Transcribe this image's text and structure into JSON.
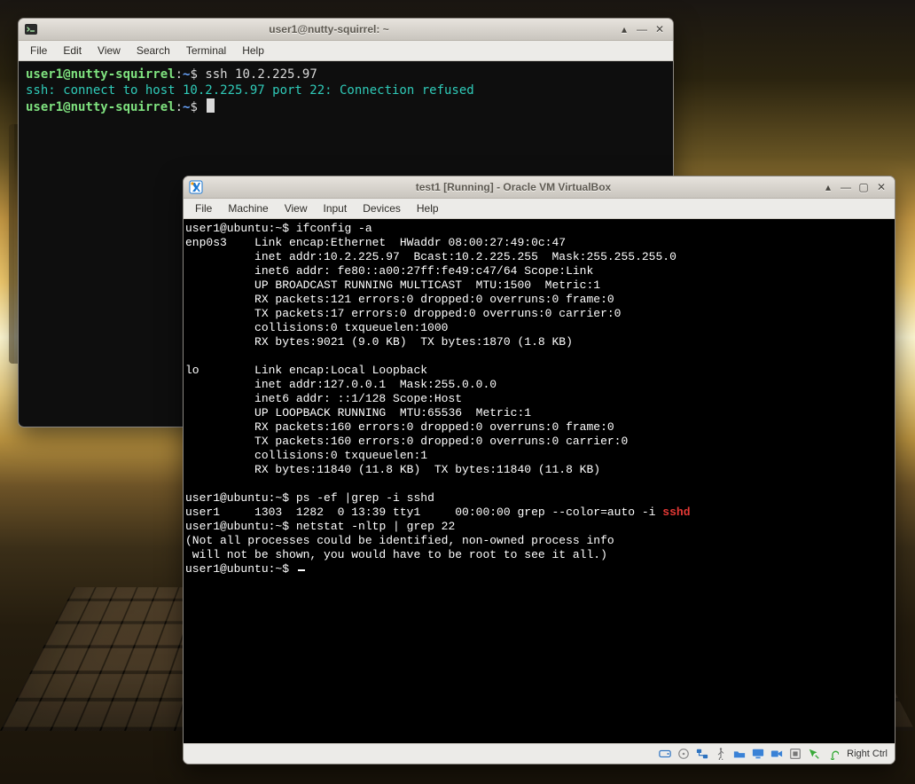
{
  "desktop": {
    "dock": true
  },
  "term_window": {
    "title": "user1@nutty-squirrel: ~",
    "menus": [
      "File",
      "Edit",
      "View",
      "Search",
      "Terminal",
      "Help"
    ],
    "prompt": {
      "userhost": "user1@nutty-squirrel",
      "sep1": ":",
      "path": "~",
      "sep2": "$"
    },
    "lines": {
      "cmd1": "ssh 10.2.225.97",
      "out1": "ssh: connect to host 10.2.225.97 port 22: Connection refused"
    },
    "ctl": {
      "up": "▴",
      "min": "—",
      "close": "✕"
    }
  },
  "vbox_window": {
    "title": "test1 [Running] - Oracle VM VirtualBox",
    "menus": [
      "File",
      "Machine",
      "View",
      "Input",
      "Devices",
      "Help"
    ],
    "ctl": {
      "up": "▴",
      "min": "—",
      "max": "▢",
      "close": "✕"
    },
    "host_key": "Right Ctrl",
    "console": {
      "p": "user1@ubuntu:~$",
      "c1": "ifconfig -a",
      "if1": [
        "enp0s3    Link encap:Ethernet  HWaddr 08:00:27:49:0c:47",
        "          inet addr:10.2.225.97  Bcast:10.2.225.255  Mask:255.255.255.0",
        "          inet6 addr: fe80::a00:27ff:fe49:c47/64 Scope:Link",
        "          UP BROADCAST RUNNING MULTICAST  MTU:1500  Metric:1",
        "          RX packets:121 errors:0 dropped:0 overruns:0 frame:0",
        "          TX packets:17 errors:0 dropped:0 overruns:0 carrier:0",
        "          collisions:0 txqueuelen:1000",
        "          RX bytes:9021 (9.0 KB)  TX bytes:1870 (1.8 KB)"
      ],
      "if2": [
        "lo        Link encap:Local Loopback",
        "          inet addr:127.0.0.1  Mask:255.0.0.0",
        "          inet6 addr: ::1/128 Scope:Host",
        "          UP LOOPBACK RUNNING  MTU:65536  Metric:1",
        "          RX packets:160 errors:0 dropped:0 overruns:0 frame:0",
        "          TX packets:160 errors:0 dropped:0 overruns:0 carrier:0",
        "          collisions:0 txqueuelen:1",
        "          RX bytes:11840 (11.8 KB)  TX bytes:11840 (11.8 KB)"
      ],
      "c2": "ps -ef |grep -i sshd",
      "ps_pre": "user1     1303  1282  0 13:39 tty1     00:00:00 grep --color=auto -i ",
      "ps_hl": "sshd",
      "c3": "netstat -nltp | grep 22",
      "note1": "(Not all processes could be identified, non-owned process info",
      "note2": " will not be shown, you would have to be root to see it all.)"
    }
  }
}
